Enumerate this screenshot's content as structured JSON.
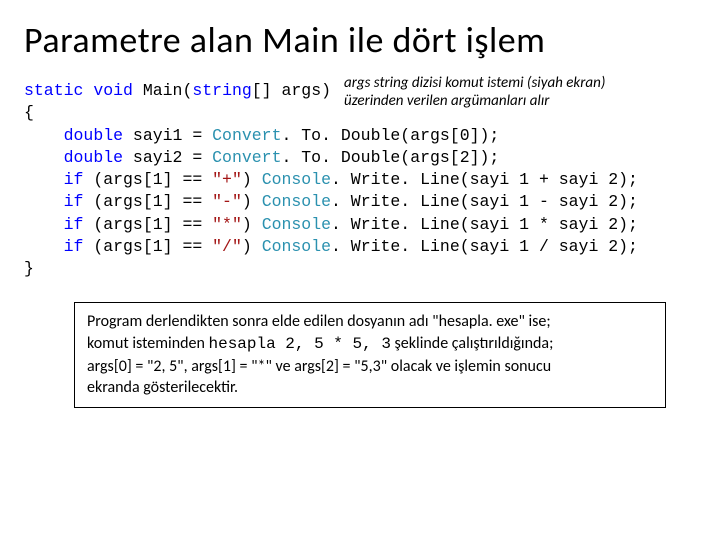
{
  "title": "Parametre alan Main ile dört işlem",
  "annotation": {
    "line1": "args string dizisi komut istemi (siyah ekran)",
    "line2": "üzerinden verilen argümanları alır"
  },
  "code": {
    "kw_static": "static",
    "kw_void": "void",
    "main": "Main",
    "kw_string_arr": "string",
    "args_param": "[] args)",
    "brace_open": "{",
    "brace_close": "}",
    "kw_double": "double",
    "sayi1_decl": " sayi1 = ",
    "sayi2_decl": " sayi2 = ",
    "convert": "Convert",
    "todouble0": ". To. Double(args[0]);",
    "todouble2": ". To. Double(args[2]);",
    "kw_if": "if",
    "args1_eq": " (args[1] == ",
    "str_plus": "\"+\"",
    "str_minus": "\"-\"",
    "str_mul": "\"*\"",
    "str_div": "\"/\"",
    "paren_sp": ") ",
    "console": "Console",
    "writeline_open": ". Write. Line(sayi 1 ",
    "op_plus": "+",
    "op_minus": "-",
    "op_mul": "*",
    "op_div": "/",
    "writeline_close": " sayi 2);"
  },
  "note": {
    "l1": "Program derlendikten sonra elde edilen dosyanın adı \"hesapla. exe\" ise;",
    "l2a": "komut isteminden ",
    "l2b": "hesapla 2, 5 * 5, 3",
    "l2c": " şeklinde çalıştırıldığında;",
    "l3": "args[0] = \"2, 5\", args[1] = \"*\" ve args[2] = \"5,3\" olacak ve işlemin sonucu",
    "l4": "ekranda gösterilecektir."
  }
}
